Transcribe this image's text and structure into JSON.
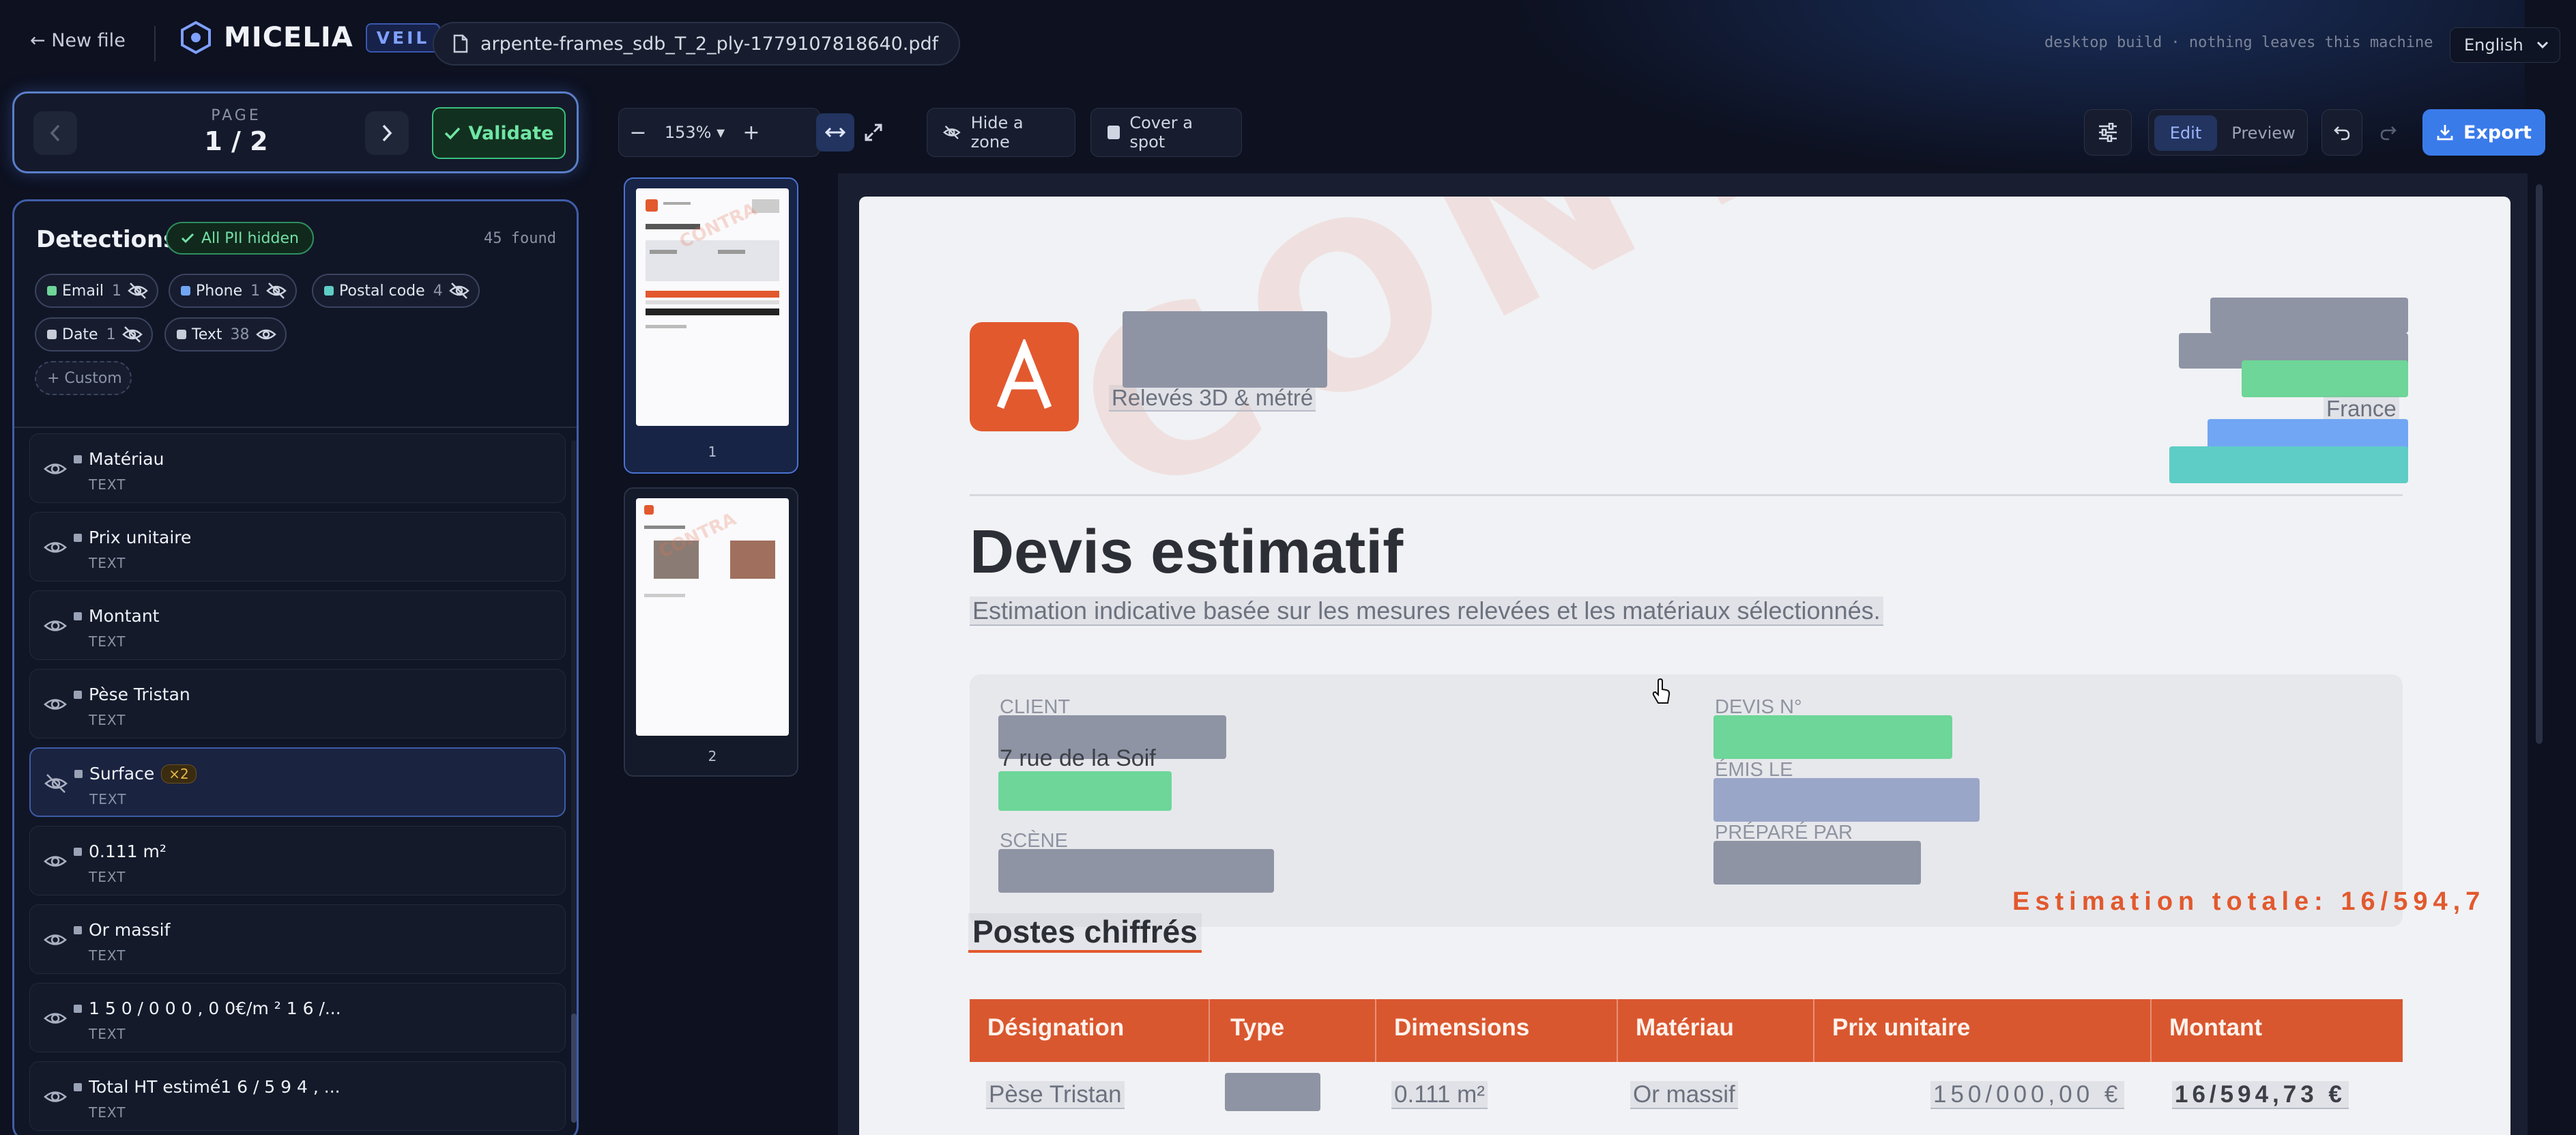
{
  "header": {
    "new_file": "← New file",
    "brand": "MICELIA",
    "badge": "VEIL",
    "filename": "arpente-frames_sdb_T_2_ply-1779107818640.pdf",
    "tagline": "desktop build · nothing leaves this machine",
    "language": "English"
  },
  "pager": {
    "label": "PAGE",
    "value": "1 / 2",
    "validate": "Validate"
  },
  "detections": {
    "title": "Detections",
    "all_pii": "All PII hidden",
    "found": "45 found",
    "chips": [
      {
        "label": "Email",
        "count": "1",
        "color": "#6dd698"
      },
      {
        "label": "Phone",
        "count": "1",
        "color": "#71a6f4"
      },
      {
        "label": "Postal code",
        "count": "4",
        "color": "#5ecdc6"
      },
      {
        "label": "Date",
        "count": "1",
        "color": "#c8ccd8"
      },
      {
        "label": "Text",
        "count": "38",
        "color": "#c8ccd8"
      }
    ],
    "custom": "+ Custom",
    "items": [
      {
        "name": "Matériau",
        "type": "TEXT"
      },
      {
        "name": "Prix unitaire",
        "type": "TEXT"
      },
      {
        "name": "Montant",
        "type": "TEXT"
      },
      {
        "name": "Pèse Tristan",
        "type": "TEXT"
      },
      {
        "name": "Surface",
        "type": "TEXT",
        "badge": "×2"
      },
      {
        "name": "0.111 m²",
        "type": "TEXT"
      },
      {
        "name": "Or massif",
        "type": "TEXT"
      },
      {
        "name": "1 5 0 / 0 0 0 , 0 0€/m ² 1 6 /...",
        "type": "TEXT"
      },
      {
        "name": "Total HT estimé1 6 / 5 9 4 , ...",
        "type": "TEXT"
      }
    ]
  },
  "toolbar": {
    "zoom": "153%",
    "hide_zone": "Hide a zone",
    "cover_spot": "Cover a spot",
    "edit": "Edit",
    "preview": "Preview",
    "export": "Export"
  },
  "thumbnails": [
    "1",
    "2"
  ],
  "document": {
    "watermark": "CONTRACT",
    "tagline": "Relevés 3D & métré",
    "country": "France",
    "title": "Devis estimatif",
    "subtitle": "Estimation indicative basée sur les mesures relevées et les matériaux sélectionnés.",
    "labels": {
      "client": "CLIENT",
      "address": "7 rue de la Soif",
      "scene": "SCÈNE",
      "devis": "DEVIS N°",
      "emis": "ÉMIS LE",
      "prepare": "PRÉPARÉ PAR"
    },
    "estimate": "Estimation totale: 16/594,7",
    "section": "Postes chiffrés",
    "table": {
      "headers": [
        "Désignation",
        "Type",
        "Dimensions",
        "Matériau",
        "Prix unitaire",
        "Montant"
      ],
      "row": [
        "Pèse Tristan",
        "",
        "0.111 m²",
        "Or massif",
        "150/000,00 €",
        "16/594,73 €"
      ]
    }
  }
}
